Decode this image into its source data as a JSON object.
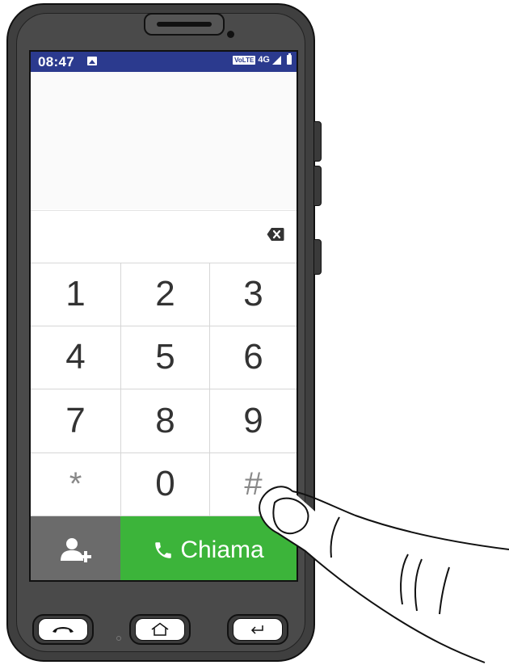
{
  "status_bar": {
    "time": "08:47",
    "volte": "VoLTE",
    "network": "4G"
  },
  "dialer": {
    "keys": [
      "1",
      "2",
      "3",
      "4",
      "5",
      "6",
      "7",
      "8",
      "9",
      "*",
      "0",
      "#"
    ],
    "call_label": "Chiama"
  },
  "icons": {
    "status": [
      "image-notification-icon",
      "signal-icon",
      "battery-icon"
    ],
    "backspace": "backspace-icon",
    "add_contact": "add-contact-icon",
    "call": "phone-icon",
    "hardware": [
      "end-call-icon",
      "home-icon",
      "back-icon"
    ]
  },
  "colors": {
    "status_bar": "#2b3a8e",
    "call_button": "#3cb43a",
    "add_contact_button": "#6b6b6b"
  }
}
